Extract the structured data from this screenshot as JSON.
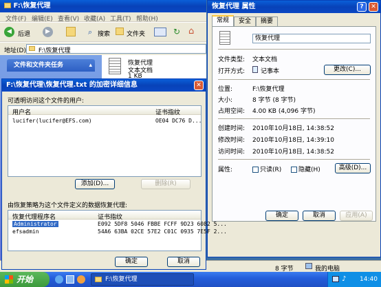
{
  "explorer": {
    "title": "F:\\恢复代理",
    "menu": [
      "文件(F)",
      "编辑(E)",
      "查看(V)",
      "收藏(A)",
      "工具(T)",
      "帮助(H)"
    ],
    "toolbar": {
      "back": "后退",
      "search": "搜索",
      "folders": "文件夹"
    },
    "address_label": "地址(D)",
    "address_value": "F:\\恢复代理",
    "task_pane_title": "文件和文件夹任务",
    "file": {
      "name": "恢复代理",
      "type": "文本文档",
      "size": "1 KB"
    },
    "status_size": "8 字节",
    "status_zone": "我的电脑"
  },
  "encrypt_dialog": {
    "title": "F:\\恢复代理\\恢复代理.txt 的加密详细信息",
    "users_label": "可透明访问这个文件的用户:",
    "users_headers": [
      "用户名",
      "证书指纹"
    ],
    "users_rows": [
      {
        "name": "lucifer(lucifer@EFS.com)",
        "thumb": "OE04 DC76 D..."
      }
    ],
    "add_button": "添加(D)...",
    "remove_button": "删除(R)",
    "agents_label": "由恢复策略为这个文件定义的数据恢复代理:",
    "agents_headers": [
      "恢复代理程序名",
      "证书指纹"
    ],
    "agents_rows": [
      {
        "name": "Administrator",
        "thumb": "E092 5DF8 5046 FBBE FCFF 9D23 6082 5..."
      },
      {
        "name": "efsadmin",
        "thumb": "54A6 63BA 02CE 57E2 C01C 0935 7E5F 2..."
      }
    ],
    "ok_button": "确定",
    "cancel_button": "取消"
  },
  "props_dialog": {
    "title": "恢复代理 属性",
    "tabs": [
      "常规",
      "安全",
      "摘要"
    ],
    "file_name": "恢复代理",
    "labels": {
      "type": "文件类型:",
      "open_with": "打开方式:",
      "location": "位置:",
      "size": "大小:",
      "size_on_disk": "占用空间:",
      "created": "创建时间:",
      "modified": "修改时间:",
      "accessed": "访问时间:",
      "attributes": "属性:"
    },
    "values": {
      "type": "文本文档",
      "open_with": "记事本",
      "location": "F:\\恢复代理",
      "size": "8 字节 (8 字节)",
      "size_on_disk": "4.00 KB (4,096 字节)",
      "created": "2010年10月18日, 14:38:52",
      "modified": "2010年10月18日, 14:39:10",
      "accessed": "2010年10月18日, 14:38:52"
    },
    "change_button": "更改(C)...",
    "readonly_label": "只读(R)",
    "hidden_label": "隐藏(H)",
    "advanced_button": "高级(D)...",
    "ok_button": "确定",
    "cancel_button": "取消",
    "apply_button": "应用(A)"
  },
  "taskbar": {
    "start_label": "开始",
    "task_label": "F:\\恢复代理",
    "clock": "14:40"
  },
  "colors": {
    "xp_blue": "#0a48c4",
    "taskbar": "#245edb",
    "start_green": "#3c9a3c",
    "dialog_bg": "#ece9d8"
  }
}
